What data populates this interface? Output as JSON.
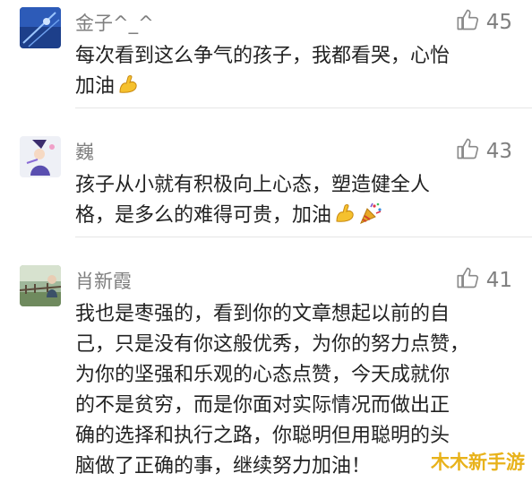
{
  "comments": [
    {
      "username": "金子^_^",
      "likes": "45",
      "lines": [
        "每次看到这么争气的孩子，我都看哭，心怡",
        "加油"
      ],
      "emoji": [
        "flexed-biceps"
      ]
    },
    {
      "username": "巍",
      "likes": "43",
      "lines": [
        "孩子从小就有积极向上心态，塑造健全人",
        "格，是多么的难得可贵，加油"
      ],
      "emoji": [
        "flexed-biceps",
        "party-popper"
      ]
    },
    {
      "username": "肖新霞",
      "likes": "41",
      "lines": [
        "我也是枣强的，看到你的文章想起以前的自",
        "己，只是没有你这般优秀，为你的努力点赞，",
        "为你的坚强和乐观的心态点赞，今天成就你",
        "的不是贫穷，而是你面对实际情况而做出正",
        "确的选择和执行之路，你聪明但用聪明的头",
        "脑做了正确的事，继续努力加油！"
      ],
      "emoji": []
    }
  ],
  "watermark": "木木新手游",
  "colors": {
    "meta_text": "#7f7f7f",
    "body_text": "#222222",
    "watermark": "#e8b21a"
  }
}
